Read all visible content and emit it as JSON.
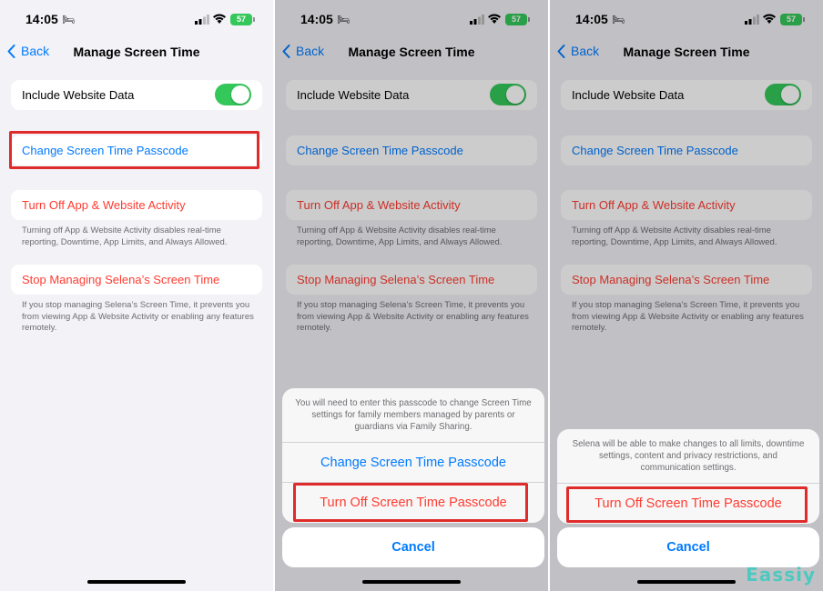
{
  "status": {
    "time": "14:05",
    "battery": "57"
  },
  "nav": {
    "back_label": "Back",
    "title": "Manage Screen Time"
  },
  "rows": {
    "include_website_data": "Include Website Data",
    "change_passcode": "Change Screen Time Passcode",
    "turn_off_activity": "Turn Off App & Website Activity",
    "turn_off_activity_footer": "Turning off App & Website Activity disables real-time reporting, Downtime, App Limits, and Always Allowed.",
    "stop_managing": "Stop Managing Selena’s Screen Time",
    "stop_managing_footer": "If you stop managing Selena’s Screen Time, it prevents you from viewing App & Website Activity or enabling any features remotely."
  },
  "toggle": {
    "include_website_data_on": true
  },
  "sheet1": {
    "message": "You will need to enter this passcode to change Screen Time settings for family members managed by parents or guardians via Family Sharing.",
    "change_label": "Change Screen Time Passcode",
    "turn_off_label": "Turn Off Screen Time Passcode",
    "cancel_label": "Cancel"
  },
  "sheet2": {
    "message": "Selena will be able to make changes to all limits, downtime settings, content and privacy restrictions, and communication settings.",
    "turn_off_label": "Turn Off Screen Time Passcode",
    "cancel_label": "Cancel"
  },
  "watermark": "Eassiy",
  "colors": {
    "accent": "#007aff",
    "destructive": "#ff3b30",
    "toggle_on": "#34c759",
    "highlight": "#e02b2b"
  }
}
